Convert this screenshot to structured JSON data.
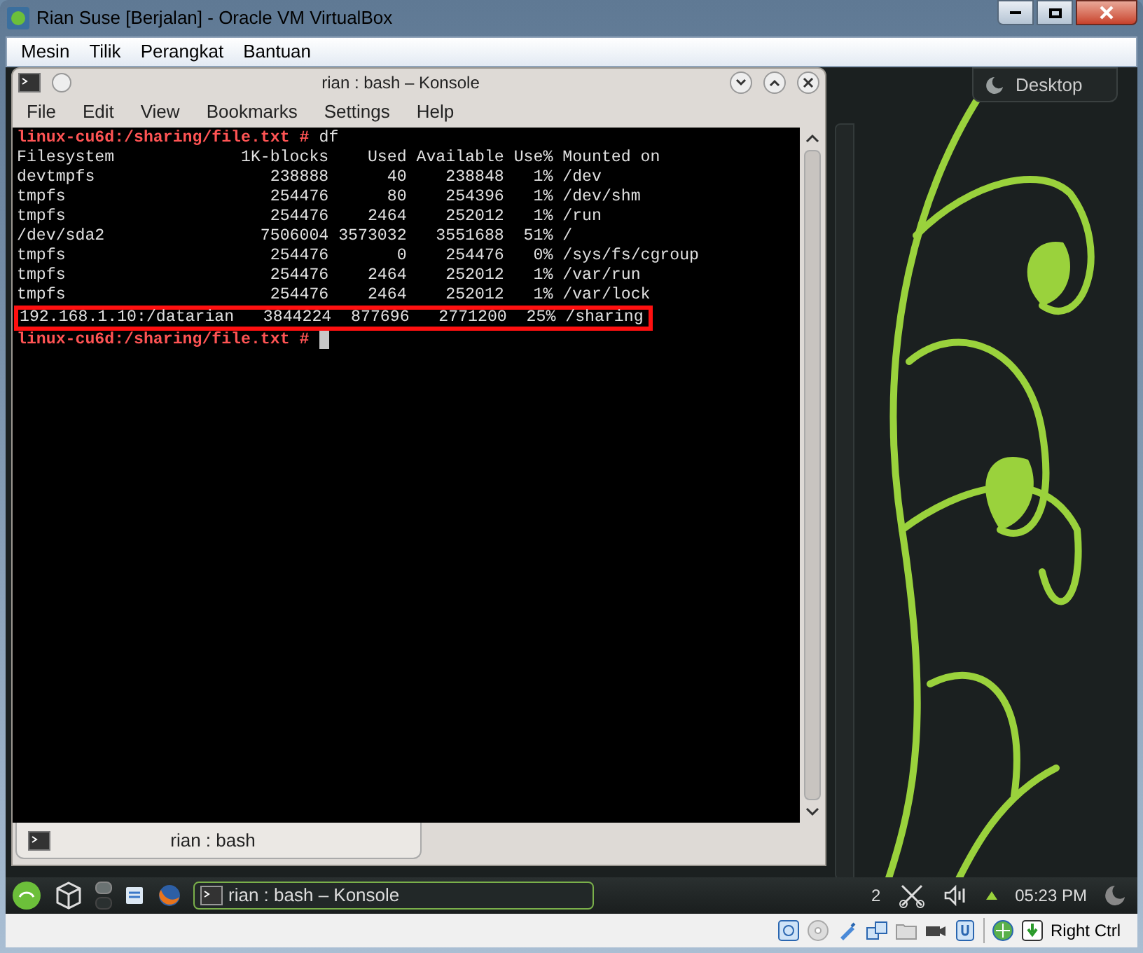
{
  "window": {
    "title": "Rian Suse [Berjalan] - Oracle VM VirtualBox"
  },
  "menu": [
    "Mesin",
    "Tilik",
    "Perangkat",
    "Bantuan"
  ],
  "konsole": {
    "title": "rian : bash – Konsole",
    "menu": [
      "File",
      "Edit",
      "View",
      "Bookmarks",
      "Settings",
      "Help"
    ],
    "lines": [
      {
        "kind": "prompt",
        "prompt": "linux-cu6d:/sharing/file.txt #",
        "command": "df"
      },
      {
        "kind": "output",
        "text": "Filesystem             1K-blocks    Used Available Use% Mounted on",
        "highlighted": false
      },
      {
        "kind": "output",
        "text": "devtmpfs                  238888      40    238848   1% /dev",
        "highlighted": false
      },
      {
        "kind": "output",
        "text": "tmpfs                     254476      80    254396   1% /dev/shm",
        "highlighted": false
      },
      {
        "kind": "output",
        "text": "tmpfs                     254476    2464    252012   1% /run",
        "highlighted": false
      },
      {
        "kind": "output",
        "text": "/dev/sda2                7506004 3573032   3551688  51% /",
        "highlighted": false
      },
      {
        "kind": "output",
        "text": "tmpfs                     254476       0    254476   0% /sys/fs/cgroup",
        "highlighted": false
      },
      {
        "kind": "output",
        "text": "tmpfs                     254476    2464    252012   1% /var/run",
        "highlighted": false
      },
      {
        "kind": "output",
        "text": "tmpfs                     254476    2464    252012   1% /var/lock",
        "highlighted": false
      },
      {
        "kind": "output",
        "text": "192.168.1.10:/datarian   3844224  877696   2771200  25% /sharing",
        "highlighted": true
      },
      {
        "kind": "prompt",
        "prompt": "linux-cu6d:/sharing/file.txt #",
        "cursor": true
      }
    ],
    "tabs": [
      {
        "label": "rian : bash",
        "selected": true
      }
    ]
  },
  "desktop_widget": {
    "label": "Desktop"
  },
  "taskbar": {
    "pager": [
      {
        "selected": true
      },
      {
        "selected": false
      }
    ],
    "tasks": [
      {
        "label": "rian : bash – Konsole",
        "selected": true
      }
    ],
    "count": "2",
    "clock": "05:23 PM"
  },
  "status_bar": {
    "host_key": "Right Ctrl"
  }
}
